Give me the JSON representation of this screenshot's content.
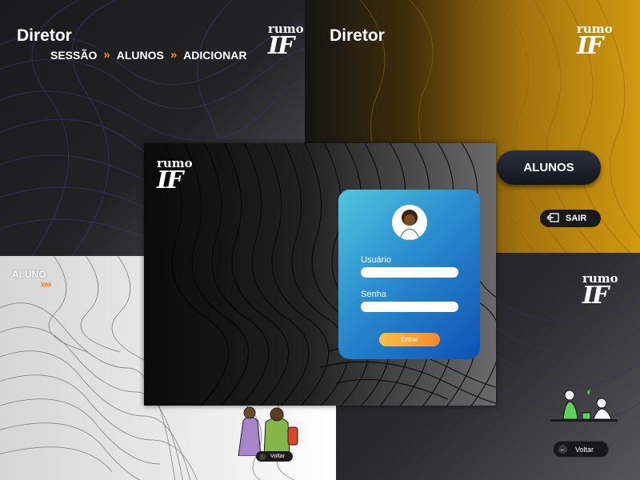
{
  "logo": {
    "line1": "rumo",
    "line2": "IF"
  },
  "panel_director_nav": {
    "title": "Diretor",
    "breadcrumb": [
      "SESSÃO",
      "ALUNOS",
      "ADICIONAR"
    ],
    "separator": "»"
  },
  "panel_director_menu": {
    "title": "Diretor",
    "students_button": "ALUNOS",
    "exit_button": "SAIR"
  },
  "panel_student": {
    "label": "ALUNO",
    "separator": "»»",
    "back_button": "Voltar"
  },
  "panel_back": {
    "back_button": "Voltar"
  },
  "login": {
    "username_label": "Usuário",
    "username_value": "",
    "password_label": "Senha",
    "password_value": "",
    "submit_label": "Entrar"
  },
  "colors": {
    "accent_orange": "#f2892c",
    "card_gradient_start": "#4fc6dc",
    "card_gradient_end": "#0f52b5",
    "gold": "#c8900f"
  }
}
